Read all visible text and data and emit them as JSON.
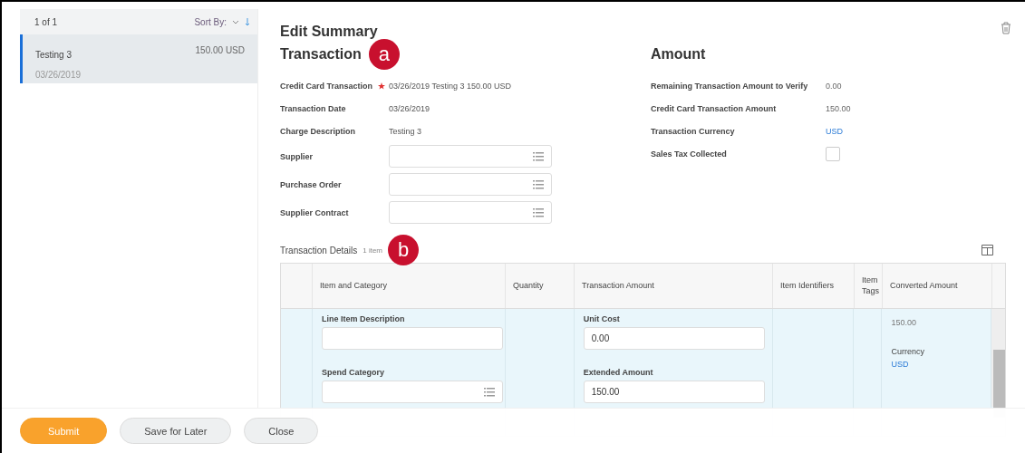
{
  "list_panel": {
    "count": "1 of 1",
    "sort_label": "Sort By:",
    "items": [
      {
        "title": "Testing 3",
        "amount": "150.00 USD",
        "date": "03/26/2019",
        "selected": true
      }
    ]
  },
  "page_title": "Edit Summary",
  "transaction": {
    "heading": "Transaction",
    "badge": "a",
    "fields": [
      {
        "kind": "text",
        "label": "Credit Card Transaction",
        "required": true,
        "value": "03/26/2019 Testing 3 150.00 USD"
      },
      {
        "kind": "text",
        "label": "Transaction Date",
        "required": false,
        "value": "03/26/2019"
      },
      {
        "kind": "text",
        "label": "Charge Description",
        "required": false,
        "value": "Testing 3"
      },
      {
        "kind": "prompt",
        "label": "Supplier",
        "required": false
      },
      {
        "kind": "prompt",
        "label": "Purchase Order",
        "required": false
      },
      {
        "kind": "prompt",
        "label": "Supplier Contract",
        "required": false
      }
    ]
  },
  "amount": {
    "heading": "Amount",
    "fields": [
      {
        "kind": "text",
        "label": "Remaining Transaction Amount to Verify",
        "value": "0.00"
      },
      {
        "kind": "text",
        "label": "Credit Card Transaction Amount",
        "value": "150.00"
      },
      {
        "kind": "link",
        "label": "Transaction Currency",
        "value": "USD"
      },
      {
        "kind": "checkbox",
        "label": "Sales Tax Collected",
        "checked": false
      }
    ]
  },
  "details": {
    "title": "Transaction Details",
    "count": "1 item",
    "badge": "b",
    "columns": [
      "Item and Category",
      "Quantity",
      "Transaction Amount",
      "Item Identifiers",
      "Item Tags",
      "Converted Amount"
    ],
    "row": {
      "line_item_description_label": "Line Item Description",
      "spend_category_label": "Spend Category",
      "unit_cost_label": "Unit Cost",
      "unit_cost": "0.00",
      "extended_amount_label": "Extended Amount",
      "extended_amount": "150.00",
      "converted_amount": "150.00",
      "currency_label": "Currency",
      "currency": "USD"
    }
  },
  "footer": {
    "buttons": [
      {
        "label": "Submit",
        "kind": "primary"
      },
      {
        "label": "Save for Later",
        "kind": "secondary"
      },
      {
        "label": "Close",
        "kind": "secondary"
      }
    ]
  }
}
